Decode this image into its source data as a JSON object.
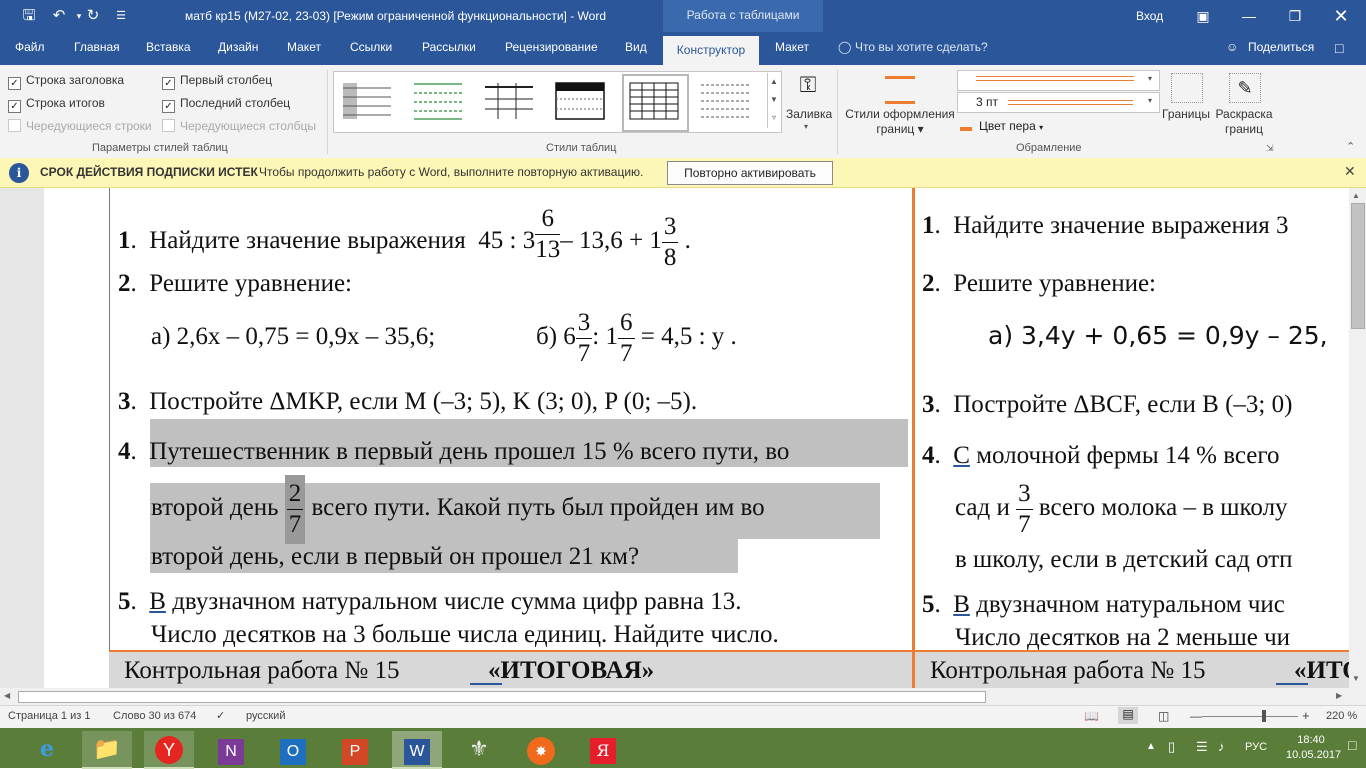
{
  "window": {
    "title": "матб кр15 (М27-02, 23-03) [Режим ограниченной функциональности]  -  Word",
    "context_tab_group": "Работа с таблицами",
    "signin": "Вход"
  },
  "tabs": {
    "file": "Файл",
    "home": "Главная",
    "insert": "Вставка",
    "design": "Дизайн",
    "layout": "Макет",
    "references": "Ссылки",
    "mailings": "Рассылки",
    "review": "Рецензирование",
    "view": "Вид",
    "constructor": "Конструктор",
    "table_layout": "Макет",
    "tell_me": "Что вы хотите сделать?",
    "share": "Поделиться"
  },
  "ribbon": {
    "options": {
      "header_row": "Строка заголовка",
      "first_column": "Первый столбец",
      "total_row": "Строка итогов",
      "last_column": "Последний столбец",
      "banded_rows": "Чередующиеся строки",
      "banded_columns": "Чередующиеся столбцы",
      "group": "Параметры стилей таблиц"
    },
    "styles_group": "Стили таблиц",
    "shading": "Заливка",
    "border_styles": [
      "Стили оформления",
      "границ"
    ],
    "pen_weight": "3 пт",
    "pen_color": "Цвет пера",
    "borders": "Границы",
    "border_painter": [
      "Раскраска",
      "границ"
    ],
    "borders_group": "Обрамление",
    "accent": "#ed7d31"
  },
  "message": {
    "title": "СРОК ДЕЙСТВИЯ ПОДПИСКИ ИСТЕК",
    "text": "Чтобы продолжить работу с Word, выполните повторную активацию.",
    "button": "Повторно активировать"
  },
  "doc": {
    "left": {
      "t1_num": "1",
      "t1_text": "Найдите значение выражения",
      "t1_expr_a": "45 : 3",
      "t1_f1": [
        "6",
        "13"
      ],
      "t1_expr_b": "– 13,6 + 1",
      "t1_f2": [
        "3",
        "8"
      ],
      "t1_end": ".",
      "t2_num": "2",
      "t2_text": "Решите уравнение:",
      "t2_a": "а) 2,6x – 0,75 = 0,9x – 35,6;",
      "t2_b_pre": "б)  6",
      "t2_bf1": [
        "3",
        "7"
      ],
      "t2_b_mid": ": 1",
      "t2_bf2": [
        "6",
        "7"
      ],
      "t2_b_end": "= 4,5 : y .",
      "t3_num": "3",
      "t3_text": "Постройте ΔMKP, если M (–3; 5), K (3; 0), P (0; –5).",
      "t4_num": "4",
      "t4_l1": "Путешественник в первый день прошел 15 % всего пути, во",
      "t4_l2a": "второй день",
      "t4_f": [
        "2",
        "7"
      ],
      "t4_l2b": "всего пути. Какой путь был пройден им во",
      "t4_l3": "второй день, если в первый он прошел 21 км?",
      "t5_num": "5",
      "t5_v": "В",
      "t5_l1": "двузначном натуральном числе сумма цифр равна 13.",
      "t5_l2": "Число десятков на 3 больше числа единиц. Найдите число."
    },
    "right": {
      "t1_num": "1",
      "t1_text": "Найдите значение выражения  3",
      "t2_num": "2",
      "t2_text": "Решите уравнение:",
      "t2_a": "а) 3,4y + 0,65 = 0,9y – 25,",
      "t3_num": "3",
      "t3_text": "Постройте ΔBCF, если B (–3; 0)",
      "t4_num": "4",
      "t4_c": "С",
      "t4_l1": "молочной фермы 14 % всего",
      "t4_l2a": "сад и",
      "t4_f": [
        "3",
        "7"
      ],
      "t4_l2b": "всего молока – в школу",
      "t4_l3": "в школу, если в детский сад отп",
      "t5_num": "5",
      "t5_v": "В",
      "t5_l1": "двузначном натуральном чис",
      "t5_l2": "Число десятков на 2 меньше чи"
    },
    "footer_left": "Контрольная работа № 15",
    "footer_left_title": "«ИТОГОВАЯ»",
    "footer_right": "Контрольная работа № 15",
    "footer_right_title": "«ИТО"
  },
  "status": {
    "page": "Страница 1 из 1",
    "words": "Слово 30 из 674",
    "lang": "русский",
    "zoom": "220 %"
  },
  "tray": {
    "lang": "РУС",
    "time": "18:40",
    "date": "10.05.2017"
  }
}
